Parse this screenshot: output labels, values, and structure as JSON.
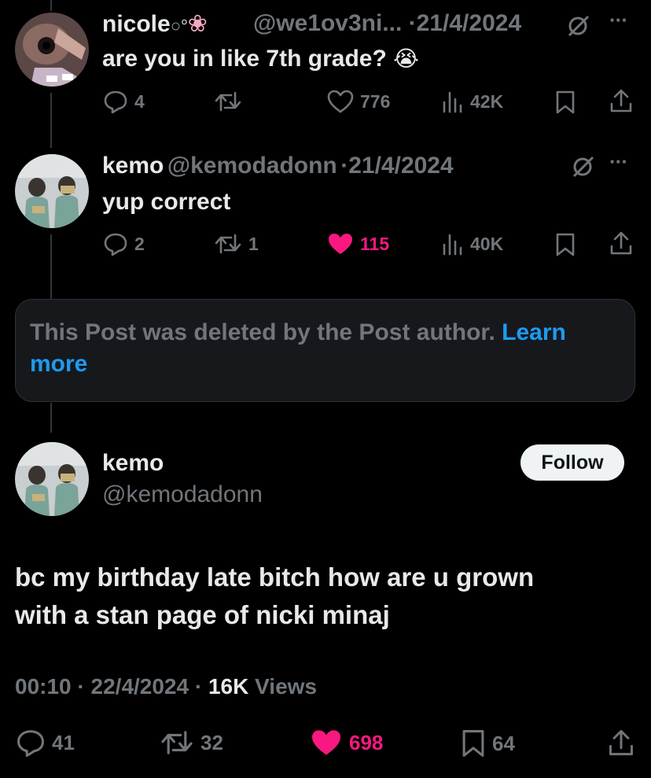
{
  "reply1": {
    "display_name": "nicole",
    "handle": "@we1ov3ni...",
    "dot": "·",
    "date": "21/4/2024",
    "text": "are you in like 7th grade?",
    "emoji": "😭",
    "stats": {
      "replies": "4",
      "retweets": "",
      "likes": "776",
      "views": "42K"
    }
  },
  "reply2": {
    "display_name": "kemo",
    "handle": "@kemodadonn",
    "dot": "·",
    "date": "21/4/2024",
    "text": "yup correct",
    "stats": {
      "replies": "2",
      "retweets": "1",
      "likes": "115",
      "views": "40K"
    }
  },
  "deleted_notice": {
    "text": "This Post was deleted by the Post author.",
    "link": "Learn more"
  },
  "main_post": {
    "display_name": "kemo",
    "handle": "@kemodadonn",
    "follow_label": "Follow",
    "text_line1": "bc my birthday late bitch how are u grown",
    "text_line2": "with a stan page of nicki minaj",
    "time": "00:10",
    "date": "22/4/2024",
    "views_count": "16K",
    "views_label": "Views",
    "stats": {
      "replies": "41",
      "retweets": "32",
      "likes": "698",
      "bookmarks": "64"
    }
  },
  "colors": {
    "background": "#000000",
    "text": "#e7e9ea",
    "muted": "#71767b",
    "like": "#f91880",
    "link": "#1d9bf0"
  }
}
